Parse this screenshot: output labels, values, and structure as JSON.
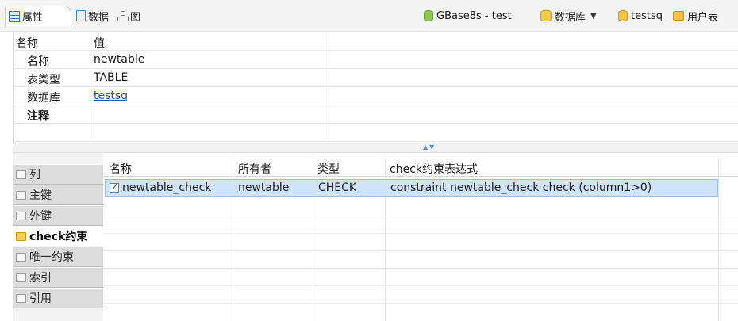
{
  "tabs": {
    "properties": "属性",
    "data": "数据",
    "diagram": "图"
  },
  "connection": {
    "server": "GBase8s - test",
    "database_label": "数据库",
    "schema": "testsq",
    "user_label": "用户表"
  },
  "properties": {
    "header": {
      "name": "名称",
      "value": "值"
    },
    "rows": [
      {
        "key": "名称",
        "value": "newtable"
      },
      {
        "key": "表类型",
        "value": "TABLE"
      },
      {
        "key": "数据库",
        "value": "testsq"
      },
      {
        "key": "注释",
        "value": ""
      }
    ]
  },
  "nav": {
    "items": [
      {
        "label": "列"
      },
      {
        "label": "主键"
      },
      {
        "label": "外键"
      },
      {
        "label": "check约束"
      },
      {
        "label": "唯一约束"
      },
      {
        "label": "索引"
      },
      {
        "label": "引用"
      }
    ]
  },
  "constraints": {
    "columns": [
      "名称",
      "所有者",
      "类型",
      "check约束表达式"
    ],
    "rows": [
      {
        "name": "newtable_check",
        "owner": "newtable",
        "type": "CHECK",
        "expression": "constraint newtable_check check  (column1>0)"
      }
    ]
  },
  "colors": {
    "selected_row": "#cfe3fb",
    "link": "#1f4fb5",
    "nav_inactive": "#dcdcdc"
  }
}
